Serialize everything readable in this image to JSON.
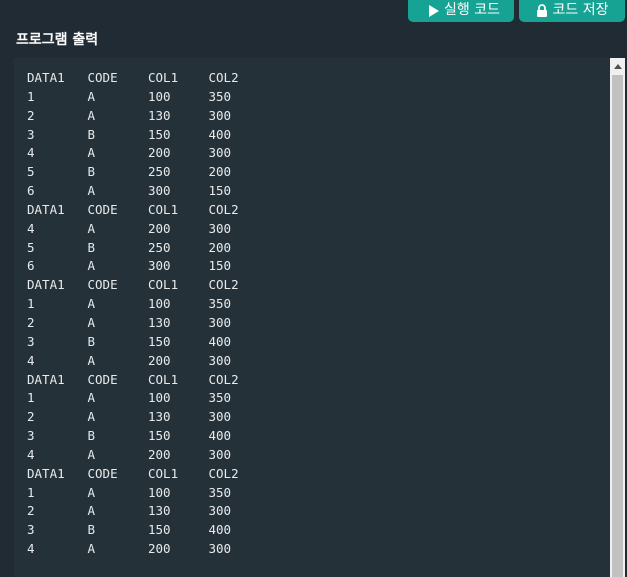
{
  "toolbar": {
    "run_label": "실행 코드",
    "save_label": "코드 저장",
    "run_icon": "play-icon",
    "save_icon": "lock-icon",
    "button_color": "#16a394"
  },
  "output": {
    "title": "프로그램 출력",
    "rows": [
      [
        "DATA1",
        "CODE",
        "COL1",
        "COL2"
      ],
      [
        "1",
        "A",
        "100",
        "350"
      ],
      [
        "2",
        "A",
        "130",
        "300"
      ],
      [
        "3",
        "B",
        "150",
        "400"
      ],
      [
        "4",
        "A",
        "200",
        "300"
      ],
      [
        "5",
        "B",
        "250",
        "200"
      ],
      [
        "6",
        "A",
        "300",
        "150"
      ],
      [
        "DATA1",
        "CODE",
        "COL1",
        "COL2"
      ],
      [
        "4",
        "A",
        "200",
        "300"
      ],
      [
        "5",
        "B",
        "250",
        "200"
      ],
      [
        "6",
        "A",
        "300",
        "150"
      ],
      [
        "DATA1",
        "CODE",
        "COL1",
        "COL2"
      ],
      [
        "1",
        "A",
        "100",
        "350"
      ],
      [
        "2",
        "A",
        "130",
        "300"
      ],
      [
        "3",
        "B",
        "150",
        "400"
      ],
      [
        "4",
        "A",
        "200",
        "300"
      ],
      [
        "DATA1",
        "CODE",
        "COL1",
        "COL2"
      ],
      [
        "1",
        "A",
        "100",
        "350"
      ],
      [
        "2",
        "A",
        "130",
        "300"
      ],
      [
        "3",
        "B",
        "150",
        "400"
      ],
      [
        "4",
        "A",
        "200",
        "300"
      ],
      [
        "DATA1",
        "CODE",
        "COL1",
        "COL2"
      ],
      [
        "1",
        "A",
        "100",
        "350"
      ],
      [
        "2",
        "A",
        "130",
        "300"
      ],
      [
        "3",
        "B",
        "150",
        "400"
      ],
      [
        "4",
        "A",
        "200",
        "300"
      ]
    ]
  }
}
